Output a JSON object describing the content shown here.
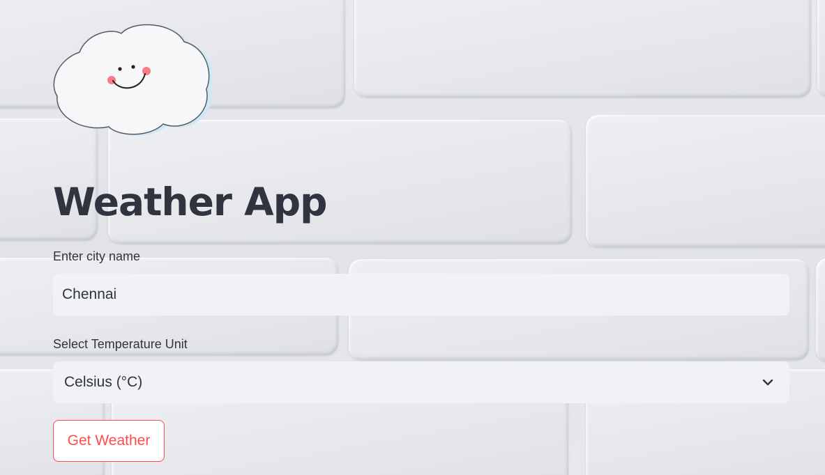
{
  "app": {
    "title": "Weather App",
    "logo_icon": "smiling-cloud-icon"
  },
  "city_field": {
    "label": "Enter city name",
    "value": "Chennai",
    "placeholder": ""
  },
  "unit_select": {
    "label": "Select Temperature Unit",
    "selected": "Celsius (°C)",
    "icon": "chevron-down-icon"
  },
  "actions": {
    "get_weather_label": "Get Weather"
  },
  "colors": {
    "text": "#31333f",
    "field_bg": "#f0f2f6",
    "button_accent": "#ff4b4b"
  }
}
